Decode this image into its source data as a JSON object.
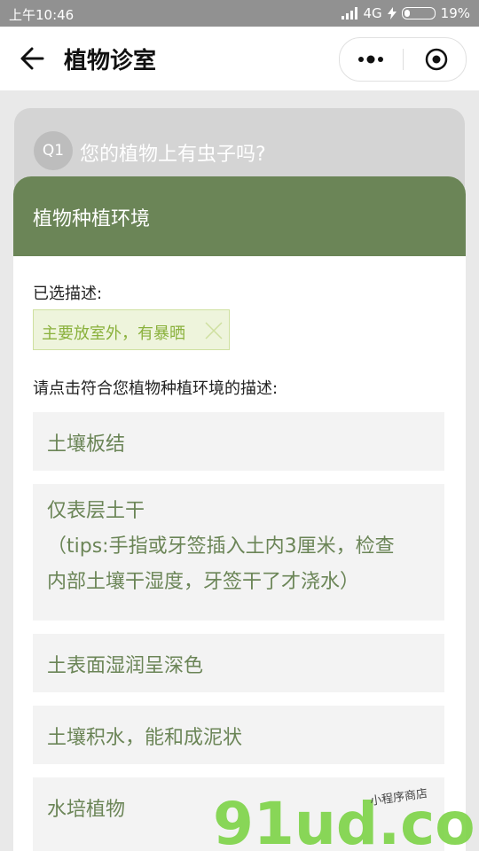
{
  "status_bar": {
    "time": "上午10:46",
    "network": "4G",
    "battery": "19%",
    "battery_level": 0.19
  },
  "navbar": {
    "title": "植物诊室",
    "back_icon": "arrow-left-icon",
    "more_icon": "more-dots-icon",
    "close_icon": "target-circle-icon"
  },
  "question": {
    "badge": "Q1",
    "text": "您的植物上有虫子吗?"
  },
  "panel": {
    "title": "植物种植环境",
    "selected_label": "已选描述:",
    "selected_tag": "主要放室外，有暴晒",
    "hint": "请点击符合您植物种植环境的描述:",
    "options": [
      {
        "lines": [
          "土壤板结"
        ]
      },
      {
        "lines": [
          "仅表层土干",
          "（tips:手指或牙签插入土内3厘米，检查",
          "内部土壤干湿度，牙签干了才浇水）"
        ]
      },
      {
        "lines": [
          "土表面湿润呈深色"
        ]
      },
      {
        "lines": [
          "土壤积水，能和成泥状"
        ]
      },
      {
        "lines": [
          "水培植物"
        ]
      }
    ]
  },
  "watermark": {
    "text": "91ud.com",
    "sub": "小程序商店"
  },
  "colors": {
    "accent": "#6b8557",
    "tag_bg": "#eef4dc",
    "tag_text": "#8ab13c",
    "watermark": "#7fd44a"
  }
}
